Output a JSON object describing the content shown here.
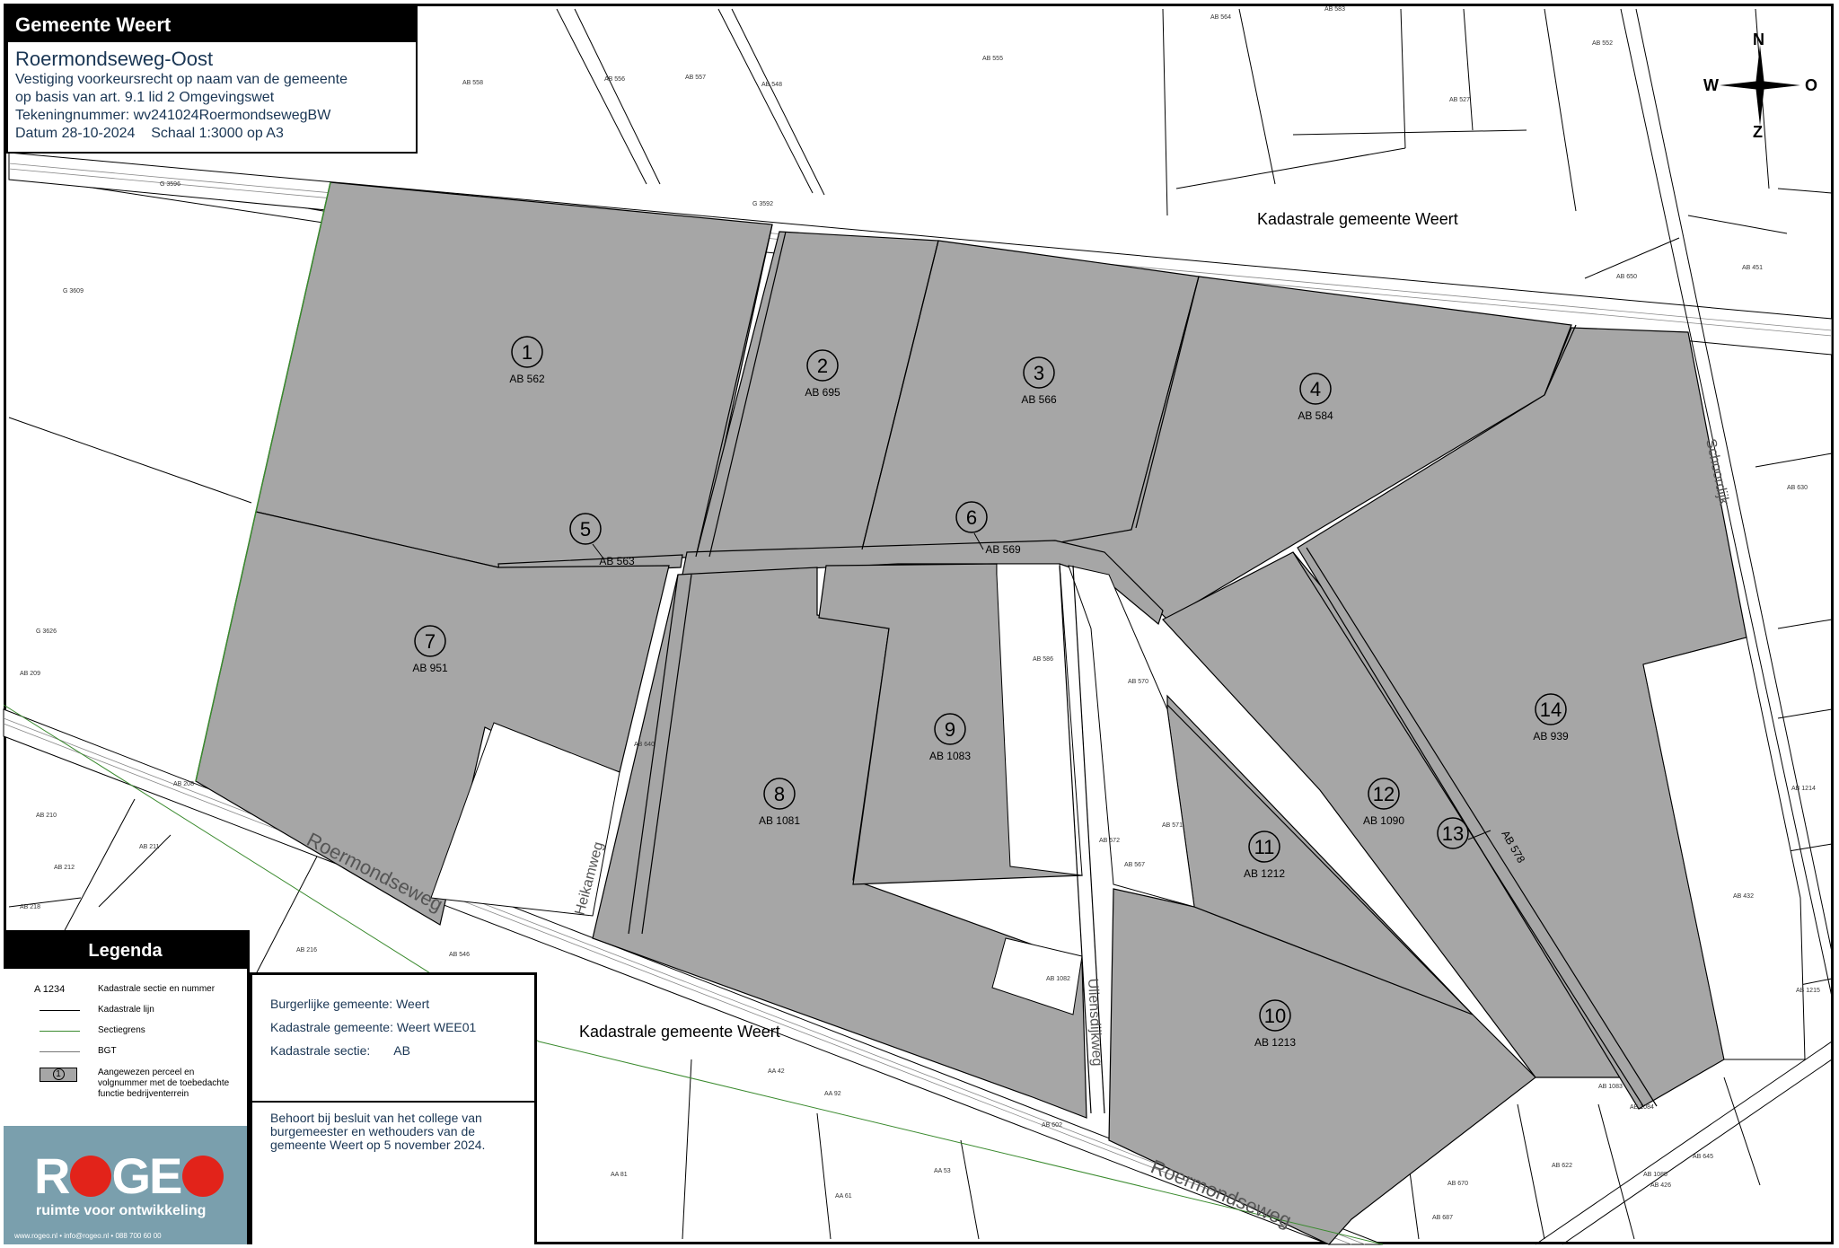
{
  "header": {
    "org": "Gemeente Weert",
    "title": "Roermondseweg-Oost",
    "line1": "Vestiging voorkeursrecht op naam van de gemeente",
    "line2": "op basis van art. 9.1 lid 2 Omgevingswet",
    "line3": "Tekeningnummer: wv241024RoermondsewegBW",
    "line4": "Datum 28-10-2024    Schaal 1:3000 op A3"
  },
  "compass": {
    "n": "N",
    "w": "W",
    "o": "O",
    "z": "Z"
  },
  "map_labels": {
    "kad_top": "Kadastrale gemeente Weert",
    "kad_bottom": "Kadastrale gemeente Weert",
    "road_roermondseweg_1": "Roermondseweg",
    "road_roermondseweg_2": "Roermondseweg",
    "road_heikamp": "Heikamweg",
    "road_uliens": "Uliensdijkweg",
    "road_schoordijk": "Schoordijk",
    "ab578": "AB 578"
  },
  "parcels": [
    {
      "num": "1",
      "code": "AB 562"
    },
    {
      "num": "2",
      "code": "AB 695"
    },
    {
      "num": "3",
      "code": "AB 566"
    },
    {
      "num": "4",
      "code": "AB 584"
    },
    {
      "num": "5",
      "code": "AB 563"
    },
    {
      "num": "6",
      "code": "AB 569"
    },
    {
      "num": "7",
      "code": "AB 951"
    },
    {
      "num": "8",
      "code": "AB 1081"
    },
    {
      "num": "9",
      "code": "AB 1083"
    },
    {
      "num": "10",
      "code": "AB 1213"
    },
    {
      "num": "11",
      "code": "AB 1212"
    },
    {
      "num": "12",
      "code": "AB 1090"
    },
    {
      "num": "13",
      "code": ""
    },
    {
      "num": "14",
      "code": "AB 939"
    }
  ],
  "small_codes": [
    "AB 564",
    "AB 583",
    "AB 555",
    "AB 558",
    "AB 556",
    "AB 557",
    "AB 548",
    "AB 552",
    "AB 527",
    "G 3592",
    "G 3596",
    "G 3609",
    "G 3626",
    "AB 209",
    "AB 208",
    "AB 210",
    "AB 211",
    "AB 212",
    "AB 218",
    "AB 216",
    "AB 546",
    "AB 640",
    "AB 586",
    "AB 570",
    "AB 572",
    "AB 567",
    "AB 571",
    "AB 1082",
    "AB 630",
    "AB 650",
    "AB 451",
    "AB 1214",
    "AB 432",
    "AB 1215",
    "AB 1083",
    "AB 1084",
    "AB 1085",
    "AB 622",
    "AB 426",
    "AB 670",
    "AB 687",
    "AB 645",
    "AA 42",
    "AA 92",
    "AB 602",
    "AA 81",
    "AA 61",
    "AA 53"
  ],
  "legend": {
    "title": "Legenda",
    "items": [
      {
        "symbol": "A 1234",
        "text": "Kadastrale sectie en nummer"
      },
      {
        "symbol": "",
        "text": "Kadastrale lijn"
      },
      {
        "symbol": "",
        "text": "Sectiegrens"
      },
      {
        "symbol": "",
        "text": "BGT"
      },
      {
        "symbol": "1",
        "text": "Aangewezen perceel en volgnummer met de toebedachte functie bedrijventerrein"
      }
    ],
    "tagline": "ruimte voor ontwikkeling",
    "logo_r": "R",
    "logo_geo": "GE",
    "contact": "www.rogeo.nl • info@rogeo.nl • 088 700 60 00"
  },
  "info": {
    "gemeente_label": "Burgerlijke gemeente:",
    "gemeente_value": "Weert",
    "kad_label": "Kadastrale gemeente:",
    "kad_value": "Weert WEE01",
    "sectie_label": "Kadastrale sectie:",
    "sectie_value": "AB",
    "note": "Behoort bij besluit van het college van burgemeester en wethouders van de gemeente Weert op 5 november 2024."
  },
  "colors": {
    "parcel_fill": "#a6a6a6",
    "sectiegrens": "#3a8a2e",
    "rogeo_bg": "#7a9fad",
    "rogeo_red": "#e2231a"
  }
}
